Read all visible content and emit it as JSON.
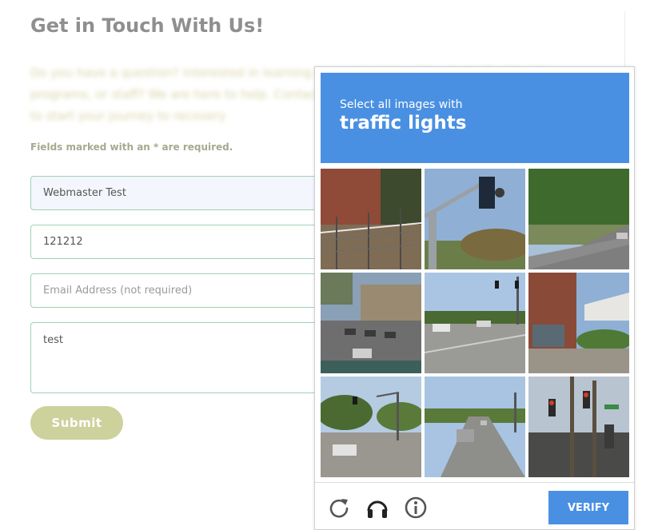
{
  "form": {
    "title": "Get in Touch With Us!",
    "intro_blurred": "Do you have a question? Interested in learning more about Hazelden Betty Ford facility, programs, or staff? We are here to help. Contact us today with all the information you need to start your journey to recovery",
    "required_note": "Fields marked with an * are required.",
    "name_value": "Webmaster Test",
    "phone_value": "121212",
    "email_placeholder": "Email Address (not required)",
    "message_value": "test",
    "submit_label": "Submit"
  },
  "captcha": {
    "instruction": "Select all images with",
    "target": "traffic lights",
    "tiles": [
      "tile-1",
      "tile-2",
      "tile-3",
      "tile-4",
      "tile-5",
      "tile-6",
      "tile-7",
      "tile-8",
      "tile-9"
    ],
    "controls": {
      "reload_icon": "reload-icon",
      "audio_icon": "headphones-icon",
      "info_icon": "info-icon"
    },
    "verify_label": "VERIFY",
    "accent_color": "#4a90e2"
  }
}
